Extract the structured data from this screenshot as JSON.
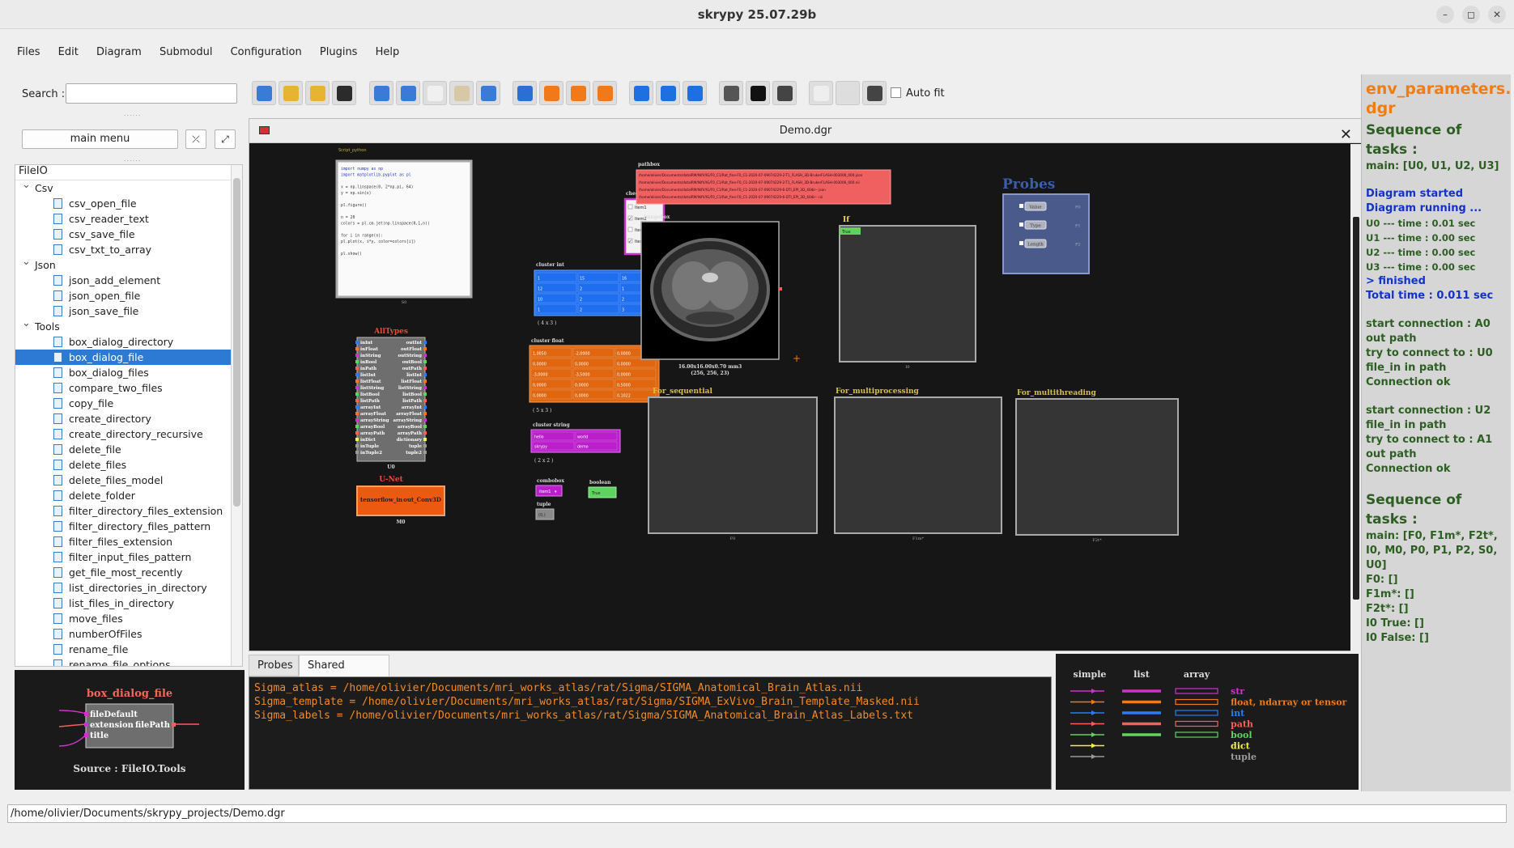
{
  "window": {
    "title": "skrypy 25.07.29b",
    "controls": {
      "minimize": "–",
      "maximize": "◻",
      "close": "✕"
    }
  },
  "menu": [
    "Files",
    "Edit",
    "Diagram",
    "Submodul",
    "Configuration",
    "Plugins",
    "Help"
  ],
  "search": {
    "label": "Search :",
    "value": ""
  },
  "toolbar": {
    "autofit_label": "Auto fit",
    "autofit_checked": false,
    "buttons": [
      {
        "icon": "new-file-icon",
        "color": "#3a7bd5"
      },
      {
        "icon": "open-folder-icon",
        "color": "#e6b332"
      },
      {
        "icon": "save-icon",
        "color": "#e6b332"
      },
      {
        "icon": "edit-icon",
        "color": "#2b2b2b"
      },
      {
        "icon": "undo-icon",
        "color": "#3a7bd5"
      },
      {
        "icon": "redo-icon",
        "color": "#3a7bd5"
      },
      {
        "icon": "copy-icon",
        "color": "#f0f0f0"
      },
      {
        "icon": "paste-icon",
        "color": "#d8c9a6"
      },
      {
        "icon": "refresh-icon",
        "color": "#3a7bd5"
      },
      {
        "icon": "text-a-icon",
        "color": "#2b6fd3"
      },
      {
        "icon": "play-orange-icon",
        "color": "#f07a1a"
      },
      {
        "icon": "step-orange-icon",
        "color": "#f07a1a"
      },
      {
        "icon": "fast-forward-orange-icon",
        "color": "#f07a1a"
      },
      {
        "icon": "play-blue-icon",
        "color": "#1e6fe0"
      },
      {
        "icon": "step-blue-icon",
        "color": "#1e6fe0"
      },
      {
        "icon": "fast-forward-blue-icon",
        "color": "#1e6fe0"
      },
      {
        "icon": "tools-icon",
        "color": "#555"
      },
      {
        "icon": "terminal-icon",
        "color": "#111"
      },
      {
        "icon": "document-icon",
        "color": "#444"
      },
      {
        "icon": "windows-icon",
        "color": "#eee"
      },
      {
        "icon": "layout-icon",
        "color": "#ddd"
      },
      {
        "icon": "fit-screen-icon",
        "color": "#444"
      }
    ]
  },
  "left": {
    "main_menu_label": "main menu",
    "collapse_label": "⤫",
    "expand_label": "⤢",
    "tree_header": "FileIO",
    "tree": [
      {
        "kind": "cat",
        "label": "Csv"
      },
      {
        "kind": "leaf",
        "label": "csv_open_file"
      },
      {
        "kind": "leaf",
        "label": "csv_reader_text"
      },
      {
        "kind": "leaf",
        "label": "csv_save_file"
      },
      {
        "kind": "leaf",
        "label": "csv_txt_to_array"
      },
      {
        "kind": "cat",
        "label": "Json"
      },
      {
        "kind": "leaf",
        "label": "json_add_element"
      },
      {
        "kind": "leaf",
        "label": "json_open_file"
      },
      {
        "kind": "leaf",
        "label": "json_save_file"
      },
      {
        "kind": "cat",
        "label": "Tools"
      },
      {
        "kind": "leaf",
        "label": "box_dialog_directory"
      },
      {
        "kind": "leaf",
        "label": "box_dialog_file",
        "selected": true
      },
      {
        "kind": "leaf",
        "label": "box_dialog_files"
      },
      {
        "kind": "leaf",
        "label": "compare_two_files"
      },
      {
        "kind": "leaf",
        "label": "copy_file"
      },
      {
        "kind": "leaf",
        "label": "create_directory"
      },
      {
        "kind": "leaf",
        "label": "create_directory_recursive"
      },
      {
        "kind": "leaf",
        "label": "delete_file"
      },
      {
        "kind": "leaf",
        "label": "delete_files"
      },
      {
        "kind": "leaf",
        "label": "delete_files_model"
      },
      {
        "kind": "leaf",
        "label": "delete_folder"
      },
      {
        "kind": "leaf",
        "label": "filter_directory_files_extension"
      },
      {
        "kind": "leaf",
        "label": "filter_directory_files_pattern"
      },
      {
        "kind": "leaf",
        "label": "filter_files_extension"
      },
      {
        "kind": "leaf",
        "label": "filter_input_files_pattern"
      },
      {
        "kind": "leaf",
        "label": "get_file_most_recently"
      },
      {
        "kind": "leaf",
        "label": "list_directories_in_directory"
      },
      {
        "kind": "leaf",
        "label": "list_files_in_directory"
      },
      {
        "kind": "leaf",
        "label": "move_files"
      },
      {
        "kind": "leaf",
        "label": "numberOfFiles"
      },
      {
        "kind": "leaf",
        "label": "rename_file"
      },
      {
        "kind": "leaf",
        "label": "rename_file_options"
      }
    ],
    "preview": {
      "title": "box_dialog_file",
      "inputs": [
        "fileDefault",
        "extension",
        "title"
      ],
      "output": "filePath",
      "source": "Source : FileIO.Tools"
    }
  },
  "document": {
    "title": "Demo.dgr",
    "close": "✕",
    "blocks": {
      "script": {
        "label": "Script_python",
        "lines": [
          "import numpy as np",
          "import matplotlib.pyplot as pl",
          "",
          "x = np.linspace(0, 2*np.pi, 64)",
          "y = np.sin(x)",
          "",
          "pl.figure()",
          "",
          "n = 20",
          "colors = pl.cm.jet(np.linspace(0,1,n))",
          "",
          "for i in range(n):",
          "    pl.plot(x, i*y, color=colors[i])",
          "",
          "pl.show()"
        ],
        "id": "S0"
      },
      "allTypes": {
        "title": "AllTypes",
        "inputs": [
          "inInt",
          "inFloat",
          "inString",
          "inBool",
          "inPath",
          "listInt",
          "listFloat",
          "listString",
          "listBool",
          "listPath",
          "arrayInt",
          "arrayFloat",
          "arrayString",
          "arrayBool",
          "arrayPath",
          "inDict",
          "inTuple",
          "inTuple2"
        ],
        "outputs": [
          "outInt",
          "outFloat",
          "outString",
          "outBool",
          "outPath",
          "listInt",
          "listFloat",
          "listString",
          "listBool",
          "listPath",
          "arrayInt",
          "arrayFloat",
          "arrayString",
          "arrayBool",
          "arrayPath",
          "dictionary",
          "tuple",
          "tuple2"
        ],
        "id": "U0"
      },
      "unet": {
        "title": "U-Net",
        "input": "tensorflow_in",
        "output": "out_Conv3D",
        "id": "M0"
      },
      "checkbox": {
        "label": "checkbox",
        "items": [
          "Item1",
          "Item2",
          "Item3",
          "Item4"
        ],
        "checked": [
          false,
          true,
          false,
          true
        ]
      },
      "clusterInt": {
        "label": "cluster int",
        "size": "( 4 x 3 )",
        "values": [
          [
            "1",
            "15",
            "16"
          ],
          [
            "12",
            "2",
            "1"
          ],
          [
            "10",
            "2",
            "2"
          ],
          [
            "1",
            "2",
            "3"
          ]
        ]
      },
      "clusterFloat": {
        "label": "cluster float",
        "size": "( 5 x 3 )",
        "values": [
          [
            "1,0050",
            "-2,0000",
            "0,0000"
          ],
          [
            "0,0000",
            "0,0000",
            "0,0000"
          ],
          [
            "-3,0000",
            "-3,5000",
            "0,0000"
          ],
          [
            "0,0000",
            "0,0000",
            "0,5000"
          ],
          [
            "0,0000",
            "0,0000",
            "0,1022"
          ]
        ]
      },
      "clusterString": {
        "label": "cluster string",
        "size": "( 2 x 2 )",
        "values": [
          [
            "hello",
            "world"
          ],
          [
            "skrypy",
            "demo"
          ]
        ]
      },
      "combobox": {
        "label": "combobox",
        "value": "item1"
      },
      "boolean": {
        "label": "boolean",
        "value": "True"
      },
      "tuple": {
        "label": "tuple",
        "value": "(0,)"
      },
      "pathbox": {
        "label": "pathbox",
        "lines": [
          "/home/olivier/Documents/dataIRM/NifV/IG/F0_C1/Rat_fine-F0_C1-2020-07-09074229-2-T1_FLASH_3D-BrukerFLASH-003006_000.json",
          "/home/olivier/Documents/dataIRM/NifV/IG/F0_C1/Rat_fine-F0_C1-2020-07-09074229-2-T1_FLASH_3D-BrukerFLASH-003006_000.nii",
          "/home/olivier/Documents/dataIRM/NifV/IG/F0_C1/Rat_fine-F0_C1-2020-07-09074229-6-DTI_EPI_3D_40dir-- json",
          "/home/olivier/Documents/dataIRM/NifV/IG/F0_C1/Rat_fine-F0_C1-2020-07-09074229-6-DTI_EPI_3D_40dir-- nii"
        ]
      },
      "imagebox": {
        "label": "imagebox",
        "info1": "16.00x16.00x0.70 mm3",
        "info2": "(256, 256, 23)"
      },
      "if": {
        "label": "If",
        "value": "True",
        "id": "I0"
      },
      "probes": {
        "title": "Probes",
        "items": [
          "Value",
          "Type",
          "Length"
        ],
        "ids": [
          "P0",
          "P1",
          "P2"
        ]
      },
      "forSeq": {
        "label": "For_sequential",
        "id": "F0"
      },
      "forMulti": {
        "label": "For_multiprocessing",
        "id": "F1m*"
      },
      "forThread": {
        "label": "For_multithreading",
        "id": "F2t*"
      }
    }
  },
  "bottom_tabs": [
    {
      "label": "Probes",
      "active": false
    },
    {
      "label": "Shared Memory",
      "active": true
    }
  ],
  "shared_memory": [
    "Sigma_atlas = /home/olivier/Documents/mri_works_atlas/rat/Sigma/SIGMA_Anatomical_Brain_Atlas.nii",
    "Sigma_template = /home/olivier/Documents/mri_works_atlas/rat/Sigma/SIGMA_ExVivo_Brain_Template_Masked.nii",
    "Sigma_labels = /home/olivier/Documents/mri_works_atlas/rat/Sigma/SIGMA_Anatomical_Brain_Atlas_Labels.txt"
  ],
  "legend": {
    "headers": [
      "simple",
      "list",
      "array"
    ],
    "rows": [
      {
        "type": "str",
        "color": "#cc33cc"
      },
      {
        "type": "float, ndarray or tensor",
        "color": "#f07a1a"
      },
      {
        "type": "int",
        "color": "#2a7bf5"
      },
      {
        "type": "path",
        "color": "#ff5a5a"
      },
      {
        "type": "bool",
        "color": "#5fd35f"
      },
      {
        "type": "dict",
        "color": "#f2f24a"
      },
      {
        "type": "tuple",
        "color": "#9a9a9a"
      }
    ]
  },
  "right_panel": {
    "title": "env_parameters.\ndgr",
    "seq1_title": "Sequence of tasks :",
    "seq1_main": "main: [U0, U1, U2, U3]",
    "run_lines": [
      "Diagram started",
      "Diagram running ..."
    ],
    "times": [
      "U0 --- time : 0.01 sec",
      "U1 --- time : 0.00 sec",
      "U2 --- time : 0.00 sec",
      "U3 --- time : 0.00 sec"
    ],
    "finished": [
      "> finished",
      "Total time : 0.011 sec"
    ],
    "conn1": [
      "start connection : A0 out path",
      "try to connect to : U0 file_in in path",
      "Connection ok"
    ],
    "conn2": [
      "start connection : U2 file_in in path",
      "try to connect to : A1 out path",
      "Connection ok"
    ],
    "seq2_title": "Sequence of tasks :",
    "seq2_lines": [
      "main: [F0, F1m*, F2t*, I0, M0, P0, P1, P2, S0, U0]",
      "F0: []",
      "F1m*: []",
      "F2t*: []",
      "I0 True: []",
      "I0 False: []"
    ]
  },
  "statusbar": {
    "path": "/home/olivier/Documents/skrypy_projects/Demo.dgr"
  }
}
